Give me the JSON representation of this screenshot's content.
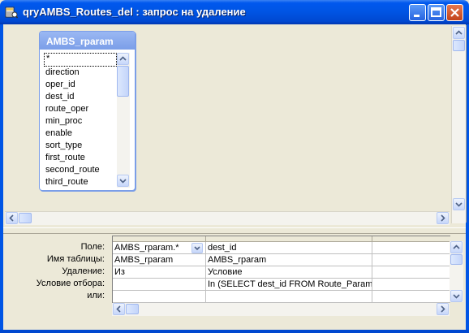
{
  "window": {
    "title": "qryAMBS_Routes_del : запрос на удаление"
  },
  "table_box": {
    "name": "AMBS_rparam",
    "fields": [
      "*",
      "direction",
      "oper_id",
      "dest_id",
      "route_oper",
      "min_proc",
      "enable",
      "sort_type",
      "first_route",
      "second_route",
      "third_route"
    ]
  },
  "grid": {
    "row_labels": [
      "Поле:",
      "Имя таблицы:",
      "Удаление:",
      "Условие отбора:",
      "или:"
    ],
    "columns": [
      {
        "field": "AMBS_rparam.*",
        "table": "AMBS_rparam",
        "delete": "Из",
        "criteria": "",
        "or": ""
      },
      {
        "field": "dest_id",
        "table": "AMBS_rparam",
        "delete": "Условие",
        "criteria": "In (SELECT dest_id FROM Route_Param;)",
        "or": ""
      },
      {
        "field": "",
        "table": "",
        "delete": "",
        "criteria": "",
        "or": ""
      }
    ]
  },
  "colors": {
    "titlebar": "#0054e3",
    "table_title": "#7b9ee8",
    "background": "#ece9d8"
  },
  "icons": [
    "query-icon",
    "minimize-icon",
    "maximize-icon",
    "close-icon",
    "chevron-up-icon",
    "chevron-down-icon",
    "chevron-left-icon",
    "chevron-right-icon"
  ]
}
